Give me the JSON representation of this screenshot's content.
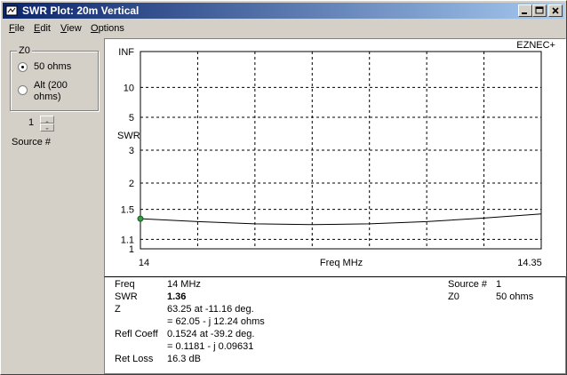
{
  "window": {
    "title": "SWR Plot: 20m Vertical",
    "buttons": [
      "minimize",
      "maximize",
      "close"
    ]
  },
  "menu": [
    "File",
    "Edit",
    "View",
    "Options"
  ],
  "left_panel": {
    "group_title": "Z0",
    "options": [
      {
        "label": "50 ohms",
        "selected": true
      },
      {
        "label_line1": "Alt (200",
        "label_line2": "ohms)",
        "selected": false
      }
    ],
    "source_value": "1",
    "source_label": "Source #"
  },
  "plot": {
    "brand": "EZNEC+",
    "ylabel": "SWR",
    "xlabel": "Freq MHz",
    "x_min_label": "14",
    "x_max_label": "14.35"
  },
  "chart_data": {
    "type": "line",
    "title": "",
    "xlabel": "Freq MHz",
    "ylabel": "SWR",
    "xlim": [
      14,
      14.35
    ],
    "y_scale": "swr-reflection",
    "y_ticks": [
      "INF",
      "10",
      "5",
      "3",
      "2",
      "1.5",
      "1.1",
      "1"
    ],
    "grid": true,
    "series": [
      {
        "x": [
          14.0,
          14.05,
          14.1,
          14.15,
          14.2,
          14.25,
          14.3,
          14.35
        ],
        "y": [
          1.36,
          1.32,
          1.29,
          1.28,
          1.29,
          1.32,
          1.37,
          1.43
        ],
        "color": "#000000"
      }
    ],
    "marker": {
      "x": 14.0,
      "y": 1.36,
      "color": "#2f9e3f"
    }
  },
  "readout": {
    "freq_label": "Freq",
    "freq_value": "14 MHz",
    "swr_label": "SWR",
    "swr_value": "1.36",
    "z_label": "Z",
    "z_line1": "63.25 at -11.16 deg.",
    "z_line2": "= 62.05 - j 12.24 ohms",
    "refl_label": "Refl Coeff",
    "refl_line1": "0.1524 at -39.2 deg.",
    "refl_line2": "= 0.1181 - j 0.09631",
    "retloss_label": "Ret Loss",
    "retloss_value": "16.3 dB",
    "source_label": "Source #",
    "source_value": "1",
    "z0_label": "Z0",
    "z0_value": "50 ohms"
  }
}
